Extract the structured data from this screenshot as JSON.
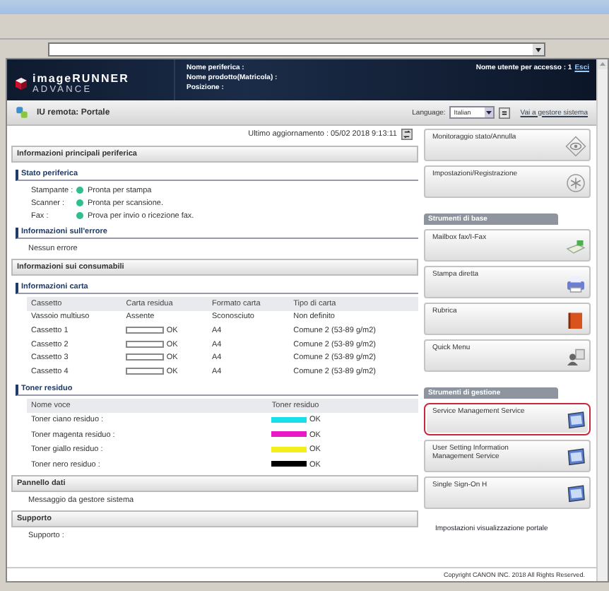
{
  "header": {
    "logo_line1": "imageRUNNER",
    "logo_line2": "ADVANCE",
    "device_info": [
      "Nome periferica :",
      "Nome prodotto(Matricola) :",
      "Posizione :"
    ],
    "user_label": "Nome utente per accesso : 1",
    "logout": "Esci"
  },
  "subheader": {
    "title": "IU remota: Portale",
    "language_label": "Language:",
    "language": "Italian",
    "system_link": "Vai a gestore sistema"
  },
  "last_update": "Ultimo aggiornamento : 05/02 2018 9:13:11",
  "device_section": {
    "title": "Informazioni principali periferica",
    "status_title": "Stato periferica",
    "status": [
      {
        "label": "Stampante :",
        "value": "Pronta per stampa",
        "color": "#2fbf8c"
      },
      {
        "label": "Scanner :",
        "value": "Pronta per scansione.",
        "color": "#2fbf8c"
      },
      {
        "label": "Fax :",
        "value": "Prova per invio o ricezione fax.",
        "color": "#2fbf8c"
      }
    ],
    "error_title": "Informazioni sull'errore",
    "error_text": "Nessun errore"
  },
  "consumables_section": {
    "title": "Informazioni sui consumabili",
    "paper_title": "Informazioni carta",
    "paper_columns": [
      "Cassetto",
      "Carta residua",
      "Formato carta",
      "Tipo di carta"
    ],
    "paper_rows": [
      {
        "kind": "text",
        "tray": "Vassoio multiuso",
        "remaining": "Assente",
        "size": "Sconosciuto",
        "type": "Non definito"
      },
      {
        "kind": "gauge",
        "tray": "Cassetto 1",
        "remaining": "OK",
        "size": "A4",
        "type": "Comune 2 (53-89 g/m2)"
      },
      {
        "kind": "gauge",
        "tray": "Cassetto 2",
        "remaining": "OK",
        "size": "A4",
        "type": "Comune 2 (53-89 g/m2)"
      },
      {
        "kind": "gauge",
        "tray": "Cassetto 3",
        "remaining": "OK",
        "size": "A4",
        "type": "Comune 2 (53-89 g/m2)"
      },
      {
        "kind": "gauge",
        "tray": "Cassetto 4",
        "remaining": "OK",
        "size": "A4",
        "type": "Comune 2 (53-89 g/m2)"
      }
    ],
    "toner_title": "Toner residuo",
    "toner_columns": [
      "Nome voce",
      "Toner residuo"
    ],
    "toner_rows": [
      {
        "name": "Toner ciano residuo :",
        "color": "#19e0e8",
        "status": "OK"
      },
      {
        "name": "Toner magenta residuo :",
        "color": "#e81ac8",
        "status": "OK"
      },
      {
        "name": "Toner giallo residuo :",
        "color": "#f2ef1a",
        "status": "OK"
      },
      {
        "name": "Toner nero residuo :",
        "color": "#000000",
        "status": "OK"
      }
    ]
  },
  "message_section": {
    "title": "Pannello dati",
    "text": "Messaggio da gestore sistema"
  },
  "support_section": {
    "title": "Supporto",
    "text": "Supporto :"
  },
  "top_buttons": [
    {
      "label": "Monitoraggio stato/Annulla",
      "highlighted": false
    },
    {
      "label": "Impostazioni/Registrazione",
      "highlighted": false
    }
  ],
  "basic_tools": {
    "title": "Strumenti di base",
    "items": [
      {
        "label": "Mailbox fax/I-Fax",
        "highlighted": false
      },
      {
        "label": "Stampa diretta",
        "highlighted": false
      },
      {
        "label": "Rubrica",
        "highlighted": false
      },
      {
        "label": "Quick Menu",
        "highlighted": false
      }
    ]
  },
  "management_tools": {
    "title": "Strumenti di gestione",
    "items": [
      {
        "label": "Service Management Service",
        "highlighted": true
      },
      {
        "label": "User Setting Information Management Service",
        "highlighted": false
      },
      {
        "label": "Single Sign-On H",
        "highlighted": false
      }
    ]
  },
  "portal_settings_link": "Impostazioni visualizzazione portale",
  "copyright": "Copyright CANON INC. 2018 All Rights Reserved."
}
